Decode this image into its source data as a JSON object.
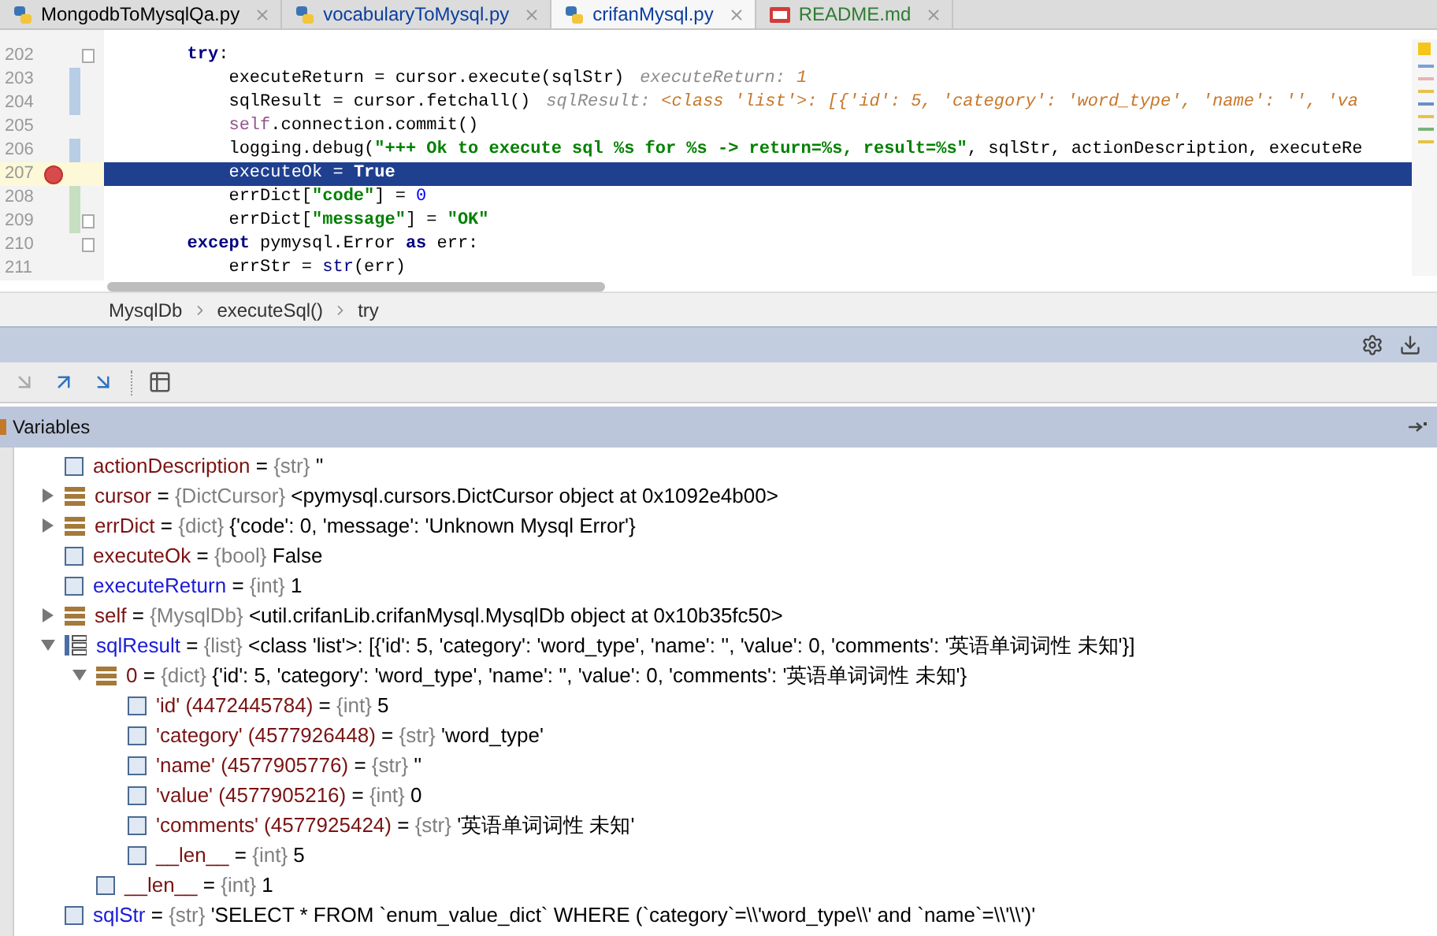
{
  "tabs": [
    {
      "label": "MongodbToMysqlQa.py",
      "kind": "python",
      "selected": false,
      "color": "#000000"
    },
    {
      "label": "vocabularyToMysql.py",
      "kind": "python",
      "selected": false,
      "color": "#0a3ea0"
    },
    {
      "label": "crifanMysql.py",
      "kind": "python",
      "selected": true,
      "color": "#0a3ea0"
    },
    {
      "label": "README.md",
      "kind": "markdown",
      "selected": false,
      "color": "#2e7d32"
    }
  ],
  "editor": {
    "lines": [
      {
        "number": "202",
        "modified": false,
        "added": false,
        "fold": true,
        "breakpoint": false,
        "current": false,
        "segments": [
          {
            "kind": "kw",
            "text": "        try"
          },
          {
            "kind": "plain",
            "text": ":"
          }
        ]
      },
      {
        "number": "203",
        "modified": true,
        "added": false,
        "fold": false,
        "breakpoint": false,
        "current": false,
        "segments": [
          {
            "kind": "plain",
            "text": "            executeReturn = cursor.execute(sqlStr)"
          },
          {
            "kind": "hint_label",
            "text": "executeReturn:"
          },
          {
            "kind": "hint_value",
            "text": "1"
          }
        ]
      },
      {
        "number": "204",
        "modified": true,
        "added": false,
        "fold": false,
        "breakpoint": false,
        "current": false,
        "segments": [
          {
            "kind": "plain",
            "text": "            sqlResult = cursor.fetchall()"
          },
          {
            "kind": "hint_label",
            "text": "sqlResult:"
          },
          {
            "kind": "hint_value",
            "text": "<class 'list'>: [{'id': 5, 'category': 'word_type', 'name': '', 'va"
          }
        ]
      },
      {
        "number": "205",
        "modified": false,
        "added": false,
        "fold": false,
        "breakpoint": false,
        "current": false,
        "segments": [
          {
            "kind": "self",
            "text": "            self"
          },
          {
            "kind": "plain",
            "text": ".connection.commit()"
          }
        ]
      },
      {
        "number": "206",
        "modified": true,
        "added": false,
        "fold": false,
        "breakpoint": false,
        "current": false,
        "segments": [
          {
            "kind": "plain",
            "text": "            logging.debug("
          },
          {
            "kind": "str",
            "text": "\"+++ Ok to execute sql %s for %s -> return=%s, result=%s\""
          },
          {
            "kind": "plain",
            "text": ", sqlStr, actionDescription, executeRe"
          }
        ]
      },
      {
        "number": "207",
        "modified": false,
        "added": false,
        "fold": false,
        "breakpoint": true,
        "current": true,
        "segments": [
          {
            "kind": "plain",
            "text": "            executeOk = "
          },
          {
            "kind": "kw",
            "text": "True"
          }
        ]
      },
      {
        "number": "208",
        "modified": false,
        "added": true,
        "fold": false,
        "breakpoint": false,
        "current": false,
        "segments": [
          {
            "kind": "plain",
            "text": "            errDict["
          },
          {
            "kind": "str",
            "text": "\"code\""
          },
          {
            "kind": "plain",
            "text": "] = "
          },
          {
            "kind": "num",
            "text": "0"
          }
        ]
      },
      {
        "number": "209",
        "modified": false,
        "added": true,
        "fold": true,
        "breakpoint": false,
        "current": false,
        "segments": [
          {
            "kind": "plain",
            "text": "            errDict["
          },
          {
            "kind": "str",
            "text": "\"message\""
          },
          {
            "kind": "plain",
            "text": "] = "
          },
          {
            "kind": "str",
            "text": "\"OK\""
          }
        ]
      },
      {
        "number": "210",
        "modified": false,
        "added": false,
        "fold": true,
        "breakpoint": false,
        "current": false,
        "segments": [
          {
            "kind": "kw",
            "text": "        except"
          },
          {
            "kind": "plain",
            "text": " pymysql.Error "
          },
          {
            "kind": "kw",
            "text": "as"
          },
          {
            "kind": "plain",
            "text": " err:"
          }
        ]
      },
      {
        "number": "211",
        "modified": false,
        "added": false,
        "fold": false,
        "breakpoint": false,
        "current": false,
        "segments": [
          {
            "kind": "plain",
            "text": "            errStr = "
          },
          {
            "kind": "builtin",
            "text": "str"
          },
          {
            "kind": "plain",
            "text": "(err)"
          }
        ]
      }
    ]
  },
  "breadcrumb": [
    "MysqlDb",
    "executeSql()",
    "try"
  ],
  "variables_panel": {
    "title": "Variables",
    "items": [
      {
        "name": "actionDescription",
        "operator": "=",
        "type": "{str}",
        "value": "''",
        "kind": "primitive",
        "changed": false
      },
      {
        "name": "cursor",
        "operator": "=",
        "type": "{DictCursor}",
        "value": "<pymysql.cursors.DictCursor object at 0x1092e4b00>",
        "kind": "object",
        "changed": false,
        "expanded": false
      },
      {
        "name": "errDict",
        "operator": "=",
        "type": "{dict}",
        "value": "{'code': 0, 'message': 'Unknown Mysql Error'}",
        "kind": "object",
        "changed": false,
        "expanded": false
      },
      {
        "name": "executeOk",
        "operator": "=",
        "type": "{bool}",
        "value": "False",
        "kind": "primitive",
        "changed": false
      },
      {
        "name": "executeReturn",
        "operator": "=",
        "type": "{int}",
        "value": "1",
        "kind": "primitive",
        "changed": true
      },
      {
        "name": "self",
        "operator": "=",
        "type": "{MysqlDb}",
        "value": "<util.crifanLib.crifanMysql.MysqlDb object at 0x10b35fc50>",
        "kind": "object",
        "changed": false,
        "expanded": false
      },
      {
        "name": "sqlResult",
        "operator": "=",
        "type": "{list}",
        "value": "<class 'list'>: [{'id': 5, 'category': 'word_type', 'name': '', 'value': 0, 'comments': '英语单词词性 未知'}]",
        "kind": "list",
        "changed": true,
        "expanded": true,
        "children": [
          {
            "name": "0",
            "operator": "=",
            "type": "{dict}",
            "value": "{'id': 5, 'category': 'word_type', 'name': '', 'value': 0, 'comments': '英语单词词性 未知'}",
            "kind": "object",
            "changed": false,
            "expanded": true,
            "children": [
              {
                "name": "'id' (4472445784)",
                "operator": "=",
                "type": "{int}",
                "value": "5",
                "kind": "primitive",
                "changed": false
              },
              {
                "name": "'category' (4577926448)",
                "operator": "=",
                "type": "{str}",
                "value": "'word_type'",
                "kind": "primitive",
                "changed": false
              },
              {
                "name": "'name' (4577905776)",
                "operator": "=",
                "type": "{str}",
                "value": "''",
                "kind": "primitive",
                "changed": false
              },
              {
                "name": "'value' (4577905216)",
                "operator": "=",
                "type": "{int}",
                "value": "0",
                "kind": "primitive",
                "changed": false
              },
              {
                "name": "'comments' (4577925424)",
                "operator": "=",
                "type": "{str}",
                "value": "'英语单词词性 未知'",
                "kind": "primitive",
                "changed": false
              },
              {
                "name": "__len__",
                "operator": "=",
                "type": "{int}",
                "value": "5",
                "kind": "primitive",
                "changed": false
              }
            ]
          },
          {
            "name": "__len__",
            "operator": "=",
            "type": "{int}",
            "value": "1",
            "kind": "primitive",
            "changed": false
          }
        ]
      },
      {
        "name": "sqlStr",
        "operator": "=",
        "type": "{str}",
        "value": "'SELECT * FROM `enum_value_dict` WHERE (`category`=\\\\'word_type\\\\' and `name`=\\\\'\\\\')'",
        "kind": "primitive",
        "changed": true
      }
    ]
  }
}
